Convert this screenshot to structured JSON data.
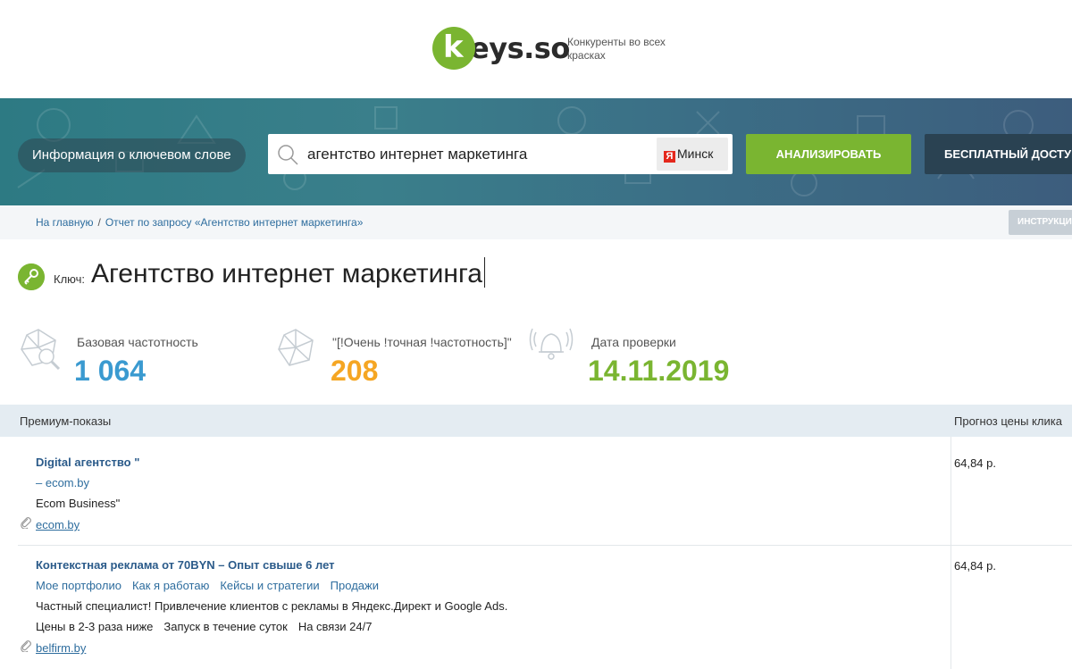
{
  "header": {
    "logo_text": "eys.so",
    "logo_letter": "k",
    "tagline": "Конкуренты во всех красках"
  },
  "banner": {
    "pill_label": "Информация о ключевом слове",
    "search_value": "агентство интернет маркетинга",
    "region_icon": "Я",
    "region": "Минск",
    "analyze_button": "АНАЛИЗИРОВАТЬ",
    "free_button": "БЕСПЛАТНЫЙ ДОСТУП"
  },
  "breadcrumbs": {
    "home": "На главную",
    "separator": "/",
    "current": "Отчет по запросу «Агентство интернет маркетинга»",
    "guide_button": "ИНСТРУКЦИЯ"
  },
  "key": {
    "label": "Ключ:",
    "title": "Агентство интернет маркетинга"
  },
  "stats": [
    {
      "label": "Базовая частотность",
      "value": "1 064",
      "color": "#3a9ad0"
    },
    {
      "label": "\"[!Очень !точная !частотность]\"",
      "value": "208",
      "color": "#f5a623"
    },
    {
      "label": "Дата проверки",
      "value": "14.11.2019",
      "color": "#7ab531"
    }
  ],
  "table": {
    "col_left": "Премиум-показы",
    "col_right": "Прогноз цены клика",
    "rows": [
      {
        "title": "Digital агентство \"",
        "line2": "– ecom.by",
        "line3": "Ecom Business\"",
        "domain": "ecom.by",
        "price": "64,84 р."
      },
      {
        "title": "Контекстная реклама от 70BYN – Опыт свыше 6 лет",
        "sitelinks": [
          "Мое портфолио",
          "Как я работаю",
          "Кейсы и стратегии",
          "Продажи"
        ],
        "description": "Частный специалист! Привлечение клиентов с рекламы в Яндекс.Директ и Google Ads.",
        "extras": [
          "Цены в 2-3 раза ниже",
          "Запуск в течение суток",
          "На связи 24/7"
        ],
        "domain": "belfirm.by",
        "price": "64,84 р."
      }
    ]
  },
  "colors": {
    "accent_green": "#7ab531",
    "dark_button": "#2a4252",
    "link_blue": "#2e6d9e"
  }
}
